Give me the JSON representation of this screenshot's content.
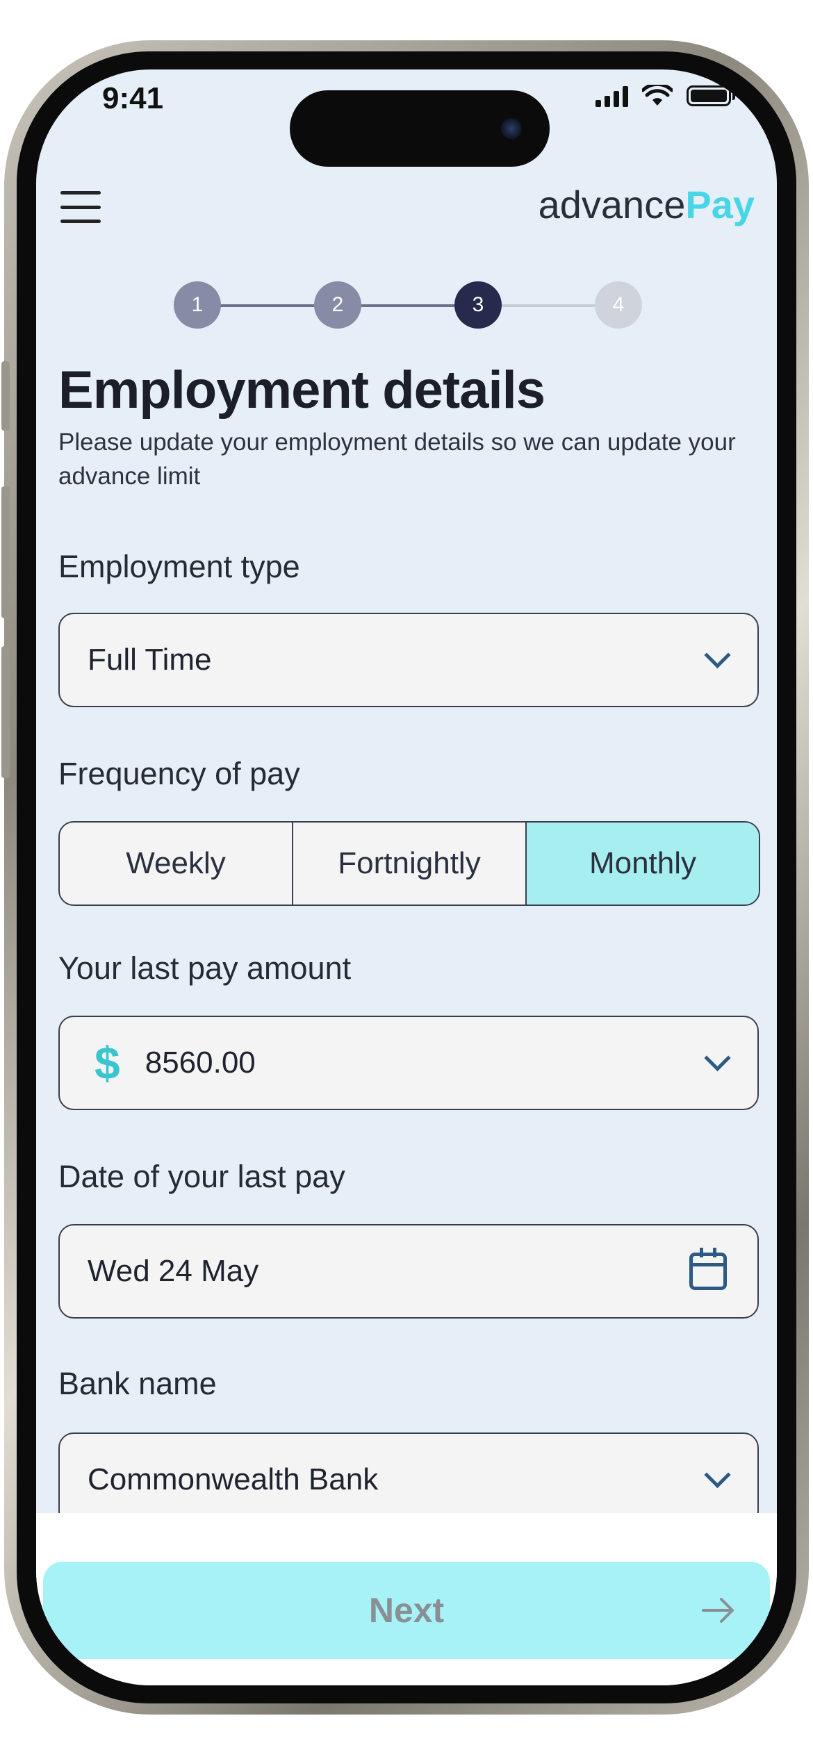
{
  "status_bar": {
    "time": "9:41"
  },
  "header": {
    "logo_part1": "advance",
    "logo_part2": "Pay"
  },
  "stepper": {
    "steps": [
      "1",
      "2",
      "3",
      "4"
    ],
    "current_step": 3
  },
  "page": {
    "title": "Employment details",
    "subtitle": "Please update your employment details so we can update your advance limit"
  },
  "form": {
    "employment_type": {
      "label": "Employment type",
      "value": "Full Time"
    },
    "pay_frequency": {
      "label": "Frequency of pay",
      "options": [
        "Weekly",
        "Fortnightly",
        "Monthly"
      ],
      "selected": "Monthly"
    },
    "last_pay_amount": {
      "label": "Your last pay amount",
      "currency_symbol": "$",
      "value": "8560.00"
    },
    "last_pay_date": {
      "label": "Date of your last pay",
      "value": "Wed 24 May"
    },
    "bank_name": {
      "label": "Bank name",
      "value": "Commonwealth Bank"
    }
  },
  "footer": {
    "next_label": "Next"
  },
  "colors": {
    "screen_background": "#e6eef8",
    "accent_teal": "#48d6e6",
    "selected_segment": "#a6eef0",
    "next_button": "#a7f2f7",
    "step_completed": "#878ca6",
    "step_current": "#262a4d",
    "step_upcoming": "#cfd4dc"
  }
}
